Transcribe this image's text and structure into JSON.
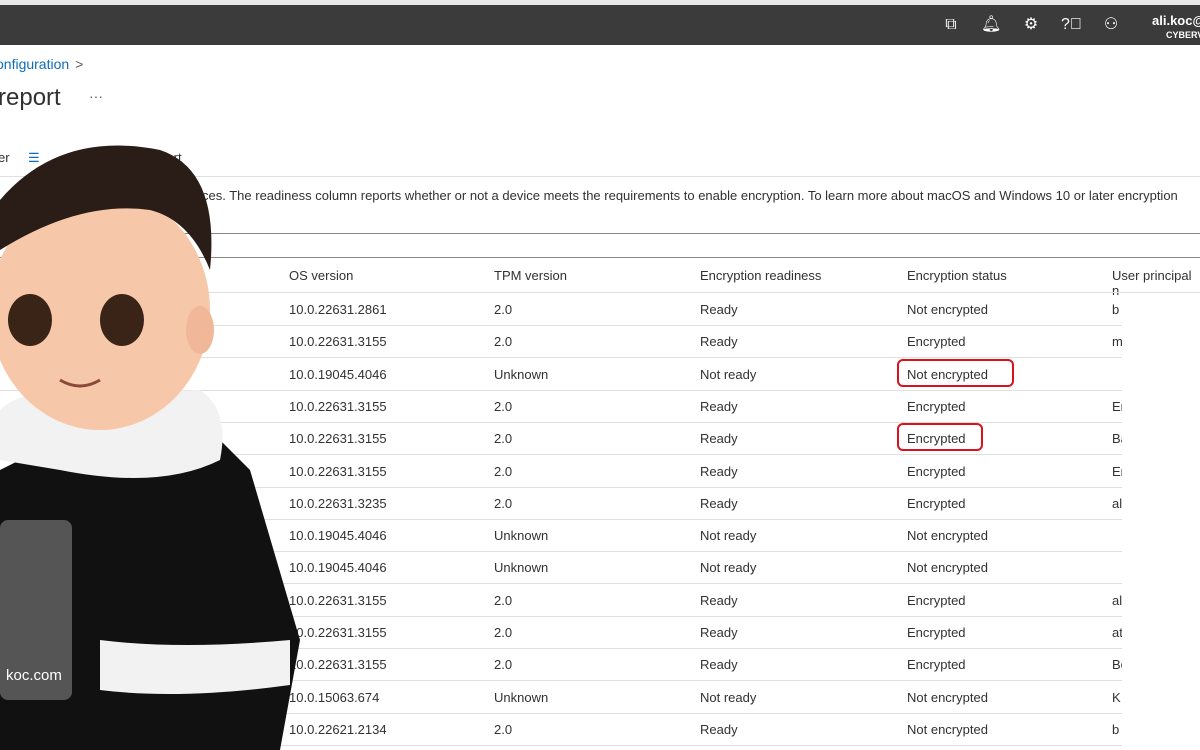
{
  "topbar": {
    "icons": [
      "filter-feedback-icon",
      "bell-icon",
      "gear-icon",
      "help-icon",
      "feedback-person-icon"
    ],
    "user": "ali.koc@",
    "tenant": "CYBERV"
  },
  "breadcrumb": {
    "item": "onfiguration",
    "separator": ">"
  },
  "page": {
    "title": "report",
    "more": "···"
  },
  "toolbar": {
    "filter_label": "er",
    "export_label": "Export"
  },
  "description": "ur devices. The readiness column reports whether or not a device meets the requirements to enable encryption. To learn more about macOS and Windows 10 or later encryption",
  "table": {
    "columns": [
      "OS version",
      "TPM version",
      "Encryption readiness",
      "Encryption status",
      "User principal n"
    ],
    "rows": [
      [
        "10.0.22631.2861",
        "2.0",
        "Ready",
        "Not encrypted",
        "b"
      ],
      [
        "10.0.22631.3155",
        "2.0",
        "Ready",
        "Encrypted",
        "m"
      ],
      [
        "10.0.19045.4046",
        "Unknown",
        "Not ready",
        "Not encrypted",
        ""
      ],
      [
        "10.0.22631.3155",
        "2.0",
        "Ready",
        "Encrypted",
        "Er"
      ],
      [
        "10.0.22631.3155",
        "2.0",
        "Ready",
        "Encrypted",
        "Ba"
      ],
      [
        "10.0.22631.3155",
        "2.0",
        "Ready",
        "Encrypted",
        "Er"
      ],
      [
        "10.0.22631.3235",
        "2.0",
        "Ready",
        "Encrypted",
        "al"
      ],
      [
        "10.0.19045.4046",
        "Unknown",
        "Not ready",
        "Not encrypted",
        ""
      ],
      [
        "10.0.19045.4046",
        "Unknown",
        "Not ready",
        "Not encrypted",
        ""
      ],
      [
        "10.0.22631.3155",
        "2.0",
        "Ready",
        "Encrypted",
        "al"
      ],
      [
        "10.0.22631.3155",
        "2.0",
        "Ready",
        "Encrypted",
        "at"
      ],
      [
        "10.0.22631.3155",
        "2.0",
        "Ready",
        "Encrypted",
        "Be"
      ],
      [
        "10.0.15063.674",
        "Unknown",
        "Not ready",
        "Not encrypted",
        "K"
      ],
      [
        "10.0.22621.2134",
        "2.0",
        "Ready",
        "Not encrypted",
        "b"
      ]
    ],
    "highlighted_rows": [
      2,
      4
    ]
  },
  "overlay": {
    "laptop_text": "koc.com"
  },
  "colors": {
    "topbar": "#3b3b3b",
    "link": "#0f6cbd",
    "highlight": "#d9121b"
  }
}
